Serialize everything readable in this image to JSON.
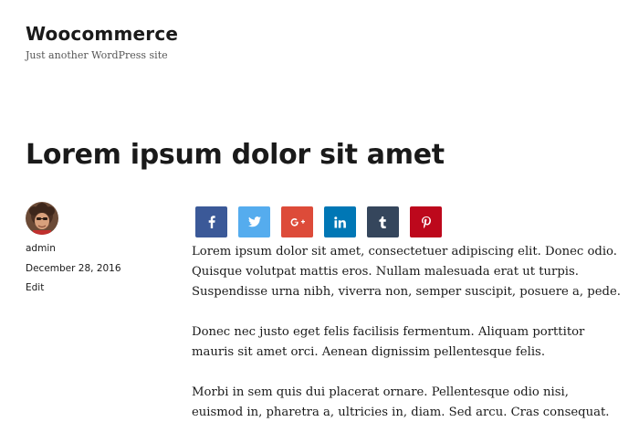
{
  "site": {
    "title": "Woocommerce",
    "tagline": "Just another WordPress site"
  },
  "post": {
    "title": "Lorem ipsum dolor sit amet",
    "author": "admin",
    "date": "December 28, 2016",
    "edit_label": "Edit",
    "paragraphs": [
      "Lorem ipsum dolor sit amet, consectetuer adipiscing elit. Donec odio. Quisque volutpat mattis eros. Nullam malesuada erat ut turpis. Suspendisse urna nibh, viverra non, semper suscipit, posuere a, pede.",
      "Donec nec justo eget felis facilisis fermentum. Aliquam porttitor mauris sit amet orci. Aenean dignissim pellentesque felis.",
      "Morbi in sem quis dui placerat ornare. Pellentesque odio nisi, euismod in, pharetra a, ultricies in, diam. Sed arcu. Cras consequat."
    ]
  },
  "share_buttons": [
    {
      "network": "facebook",
      "icon": "facebook-icon",
      "color": "#3b5998"
    },
    {
      "network": "twitter",
      "icon": "twitter-icon",
      "color": "#55acee"
    },
    {
      "network": "google-plus",
      "icon": "google-plus-icon",
      "color": "#dd4b39"
    },
    {
      "network": "linkedin",
      "icon": "linkedin-icon",
      "color": "#0077b5"
    },
    {
      "network": "tumblr",
      "icon": "tumblr-icon",
      "color": "#35465c"
    },
    {
      "network": "pinterest",
      "icon": "pinterest-icon",
      "color": "#bd081c"
    }
  ],
  "colors": {
    "text": "#1a1a1a",
    "tagline": "#555555",
    "background": "#ffffff"
  }
}
